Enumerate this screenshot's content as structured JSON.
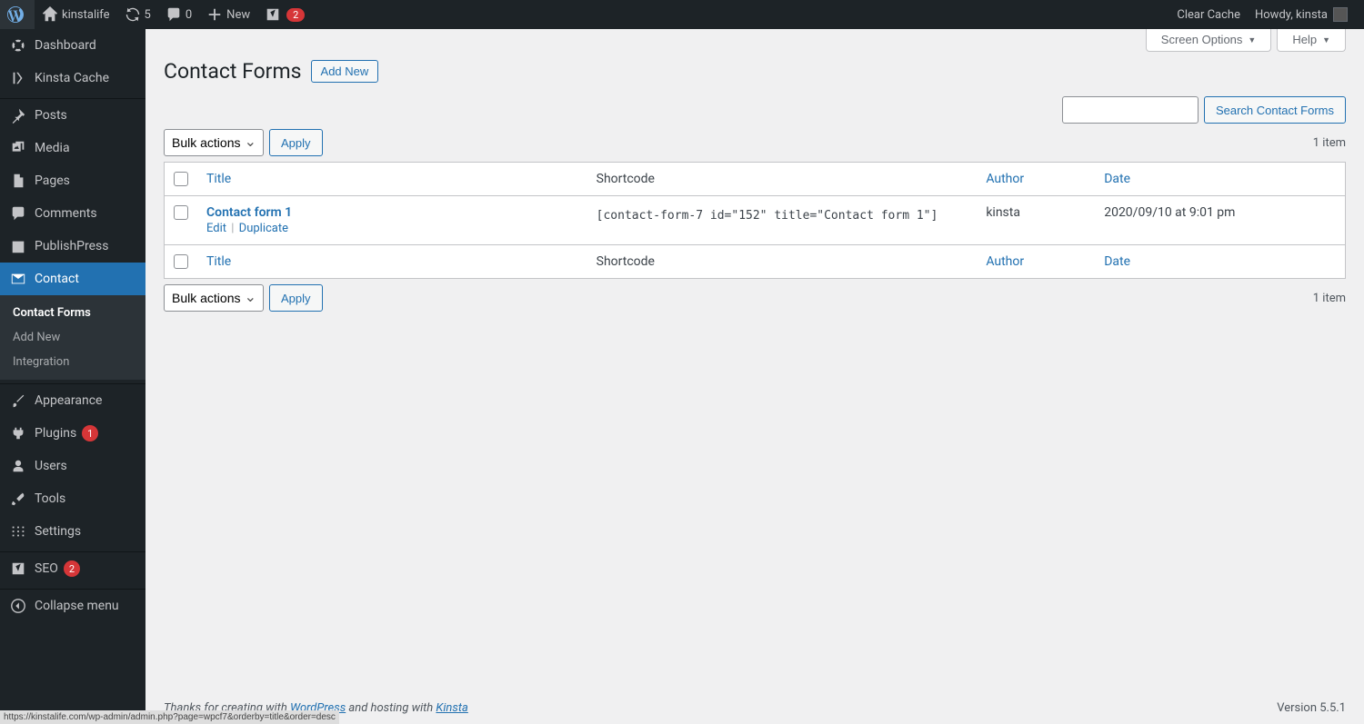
{
  "adminbar": {
    "site_name": "kinstalife",
    "updates_count": "5",
    "comments_count": "0",
    "new_label": "New",
    "yoast_badge": "2",
    "clear_cache": "Clear Cache",
    "howdy": "Howdy, kinsta"
  },
  "sidebar": {
    "items": [
      {
        "label": "Dashboard"
      },
      {
        "label": "Kinsta Cache"
      },
      {
        "label": "Posts"
      },
      {
        "label": "Media"
      },
      {
        "label": "Pages"
      },
      {
        "label": "Comments"
      },
      {
        "label": "PublishPress"
      },
      {
        "label": "Contact"
      },
      {
        "label": "Appearance"
      },
      {
        "label": "Plugins",
        "badge": "1"
      },
      {
        "label": "Users"
      },
      {
        "label": "Tools"
      },
      {
        "label": "Settings"
      },
      {
        "label": "SEO",
        "badge": "2"
      },
      {
        "label": "Collapse menu"
      }
    ],
    "submenu": [
      {
        "label": "Contact Forms"
      },
      {
        "label": "Add New"
      },
      {
        "label": "Integration"
      }
    ]
  },
  "screen_meta": {
    "screen_options": "Screen Options",
    "help": "Help"
  },
  "header": {
    "title": "Contact Forms",
    "add_new": "Add New"
  },
  "search": {
    "button": "Search Contact Forms"
  },
  "bulk": {
    "label": "Bulk actions",
    "apply": "Apply"
  },
  "displaying_num": "1 item",
  "columns": {
    "title": "Title",
    "shortcode": "Shortcode",
    "author": "Author",
    "date": "Date"
  },
  "rows": [
    {
      "title": "Contact form 1",
      "actions": {
        "edit": "Edit",
        "duplicate": "Duplicate"
      },
      "shortcode": "[contact-form-7 id=\"152\" title=\"Contact form 1\"]",
      "author": "kinsta",
      "date": "2020/09/10 at 9:01 pm"
    }
  ],
  "footer": {
    "thanks_prefix": "Thanks for creating with ",
    "wordpress": "WordPress",
    "hosting_mid": " and hosting with ",
    "kinsta": "Kinsta",
    "version": "Version 5.5.1"
  },
  "status_url": "https://kinstalife.com/wp-admin/admin.php?page=wpcf7&orderby=title&order=desc"
}
